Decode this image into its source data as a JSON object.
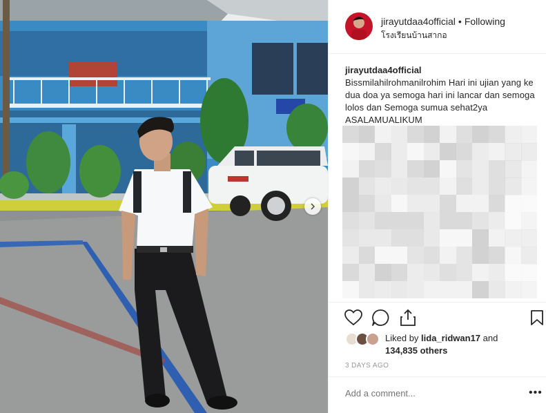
{
  "post": {
    "image_alt": "",
    "header": {
      "username": "jirayutdaa4official",
      "separator": "•",
      "follow_status": "Following",
      "location": "โรงเรียนบ้านสากอ"
    },
    "caption": {
      "username": "jirayutdaa4official",
      "text": "Bissmilahilrohmanilrohim Hari ini ujian yang ke dua doa ya semoga hari ini lancar dan semoga lolos dan Semoga sumua sehat2ya ASALAMUALIKUM"
    },
    "likes": {
      "liked_by_prefix": "Liked by",
      "liked_by_user": "lida_ridwan17",
      "and": "and",
      "others_count": "134,835 others"
    },
    "timestamp": "3 DAYS AGO",
    "comment_placeholder": "Add a comment...",
    "more_label": "•••",
    "icons": [
      "heart-icon",
      "comment-icon",
      "share-icon",
      "bookmark-icon",
      "chevron-right-icon"
    ],
    "colors": {
      "text": "#262626",
      "muted": "#999999",
      "border": "#efefef"
    }
  }
}
